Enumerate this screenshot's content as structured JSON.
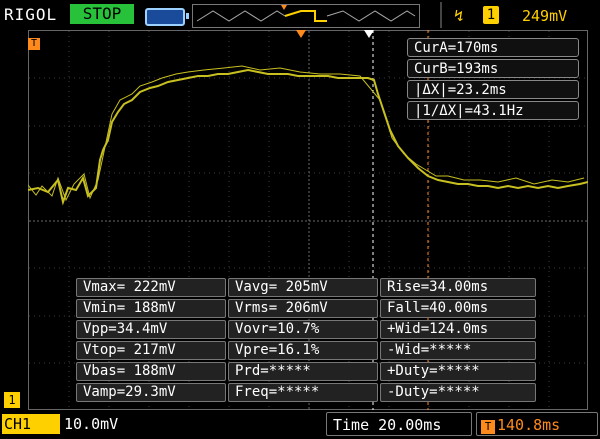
{
  "header": {
    "brand": "RIGOL",
    "run_state": "STOP",
    "trigger_channel": "1",
    "trigger_level": "249mV"
  },
  "cursors": {
    "cur_a": "CurA=170ms",
    "cur_b": "CurB=193ms",
    "delta_x": "|ΔX|=23.2ms",
    "inv_delta_x": "|1/ΔX|=43.1Hz"
  },
  "measurements": {
    "rows": [
      [
        "Vmax= 222mV",
        "Vavg= 205mV",
        "Rise=34.00ms"
      ],
      [
        "Vmin= 188mV",
        "Vrms= 206mV",
        "Fall=40.00ms"
      ],
      [
        "Vpp=34.4mV",
        "Vovr=10.7%",
        "+Wid=124.0ms"
      ],
      [
        "Vtop= 217mV",
        "Vpre=16.1%",
        "-Wid=*****"
      ],
      [
        "Vbas= 188mV",
        "Prd=*****",
        "+Duty=*****"
      ],
      [
        "Vamp=29.3mV",
        "Freq=*****",
        "-Duty=*****"
      ]
    ]
  },
  "footer": {
    "ch1_label": "CH1",
    "ch1_scale": "10.0mV",
    "time_label": "Time 20.00ms",
    "trigger_offset": "140.8ms",
    "trig_icon": "T",
    "ch_marker": "1"
  },
  "colors": {
    "trace": "#c8c020",
    "grid": "#3a3a3a",
    "cursor_a": "#ffffff",
    "cursor_b": "#ff8a1c"
  }
}
